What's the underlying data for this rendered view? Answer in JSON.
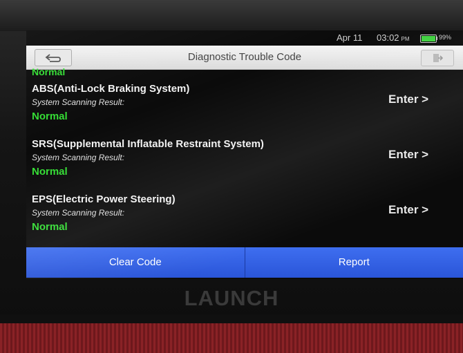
{
  "statusbar": {
    "date": "Apr 11",
    "time": "03:02",
    "ampm": "PM",
    "battery_level": 0.99,
    "battery_text": "99%"
  },
  "header": {
    "title": "Diagnostic Trouble Code",
    "back_icon": "back-arrow-icon",
    "exit_icon": "exit-icon"
  },
  "list": {
    "previous_result": "Normal",
    "items": [
      {
        "title": "ABS(Anti-Lock Braking System)",
        "subtitle": "System Scanning Result:",
        "result": "Normal",
        "action": "Enter >"
      },
      {
        "title": "SRS(Supplemental Inflatable Restraint System)",
        "subtitle": "System Scanning Result:",
        "result": "Normal",
        "action": "Enter >"
      },
      {
        "title": "EPS(Electric Power Steering)",
        "subtitle": "System Scanning Result:",
        "result": "Normal",
        "action": "Enter >"
      }
    ]
  },
  "actions": {
    "clear_code": "Clear Code",
    "report": "Report"
  },
  "device": {
    "brand": "LAUNCH"
  },
  "colors": {
    "result_green": "#33dd33",
    "button_blue": "#2f5fe6",
    "titlebar": "#e6e6e6"
  }
}
